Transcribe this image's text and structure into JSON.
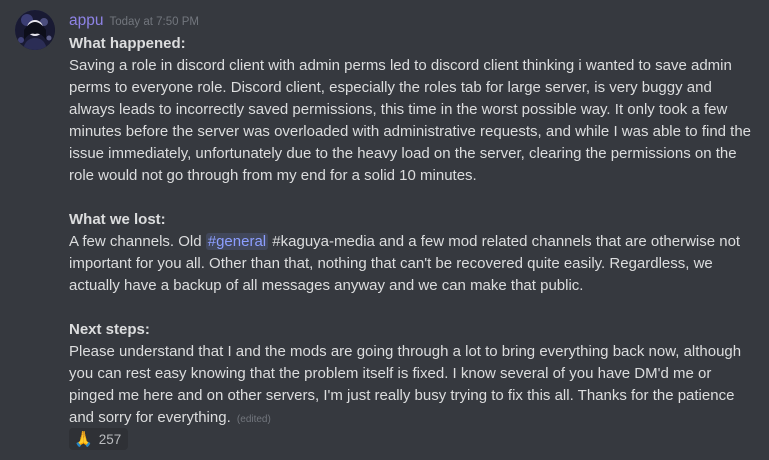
{
  "message": {
    "author": "appu",
    "timestamp": "Today at 7:50 PM",
    "sections": {
      "what_happened": {
        "title": "What happened:",
        "body": "Saving a role in discord client with admin perms led to discord client thinking i wanted to save admin perms to everyone role. Discord client, especially the roles tab for large server, is very buggy and always leads to incorrectly saved permissions, this time in the worst possible way. It only took a few minutes before the server was overloaded with administrative requests, and while I was able to find the issue immediately, unfortunately due to the heavy load on the server, clearing the permissions on the role would not go through from my end for a solid 10 minutes."
      },
      "what_we_lost": {
        "title": "What we lost:",
        "body_before": "A few channels. Old ",
        "channel_mention": "#general",
        "body_after": " #kaguya-media and a few mod related channels that are otherwise not important for you all. Other than that, nothing that can't be recovered quite easily. Regardless, we actually have a backup of all messages anyway and we can make that public."
      },
      "next_steps": {
        "title": "Next steps:",
        "body": "Please understand that I and the mods are going through a lot to bring everything back now, although you can rest easy knowing that the problem itself is fixed. I know several of you have DM'd me or pinged me here and on other servers, I'm just really busy trying to fix this all. Thanks for the patience and sorry for everything.",
        "edited_label": "(edited)"
      }
    },
    "reaction": {
      "emoji": "🙏",
      "emoji_name": "folded-hands-icon",
      "count": "257"
    }
  },
  "colors": {
    "background": "#36393f",
    "username": "#8e83e6",
    "mention": "#8c9eff",
    "text": "#dcddde",
    "muted": "#72767d"
  }
}
